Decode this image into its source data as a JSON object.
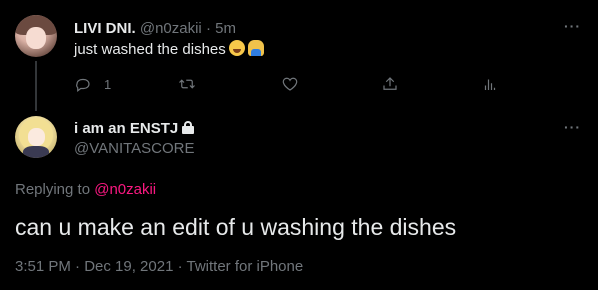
{
  "parent_tweet": {
    "author_name": "LIVI DNI.",
    "author_handle": "@n0zakii",
    "separator": "·",
    "time_ago": "5m",
    "text": "just washed the dishes",
    "emojis": [
      "face-with-tears-of-joy",
      "person-facepalming"
    ],
    "reply_count": "1",
    "more_label": "···"
  },
  "reply_tweet": {
    "author_name": "i am an ENSTJ",
    "author_handle": "@VANITASCORE",
    "protected": true,
    "more_label": "···",
    "replying_prefix": "Replying to",
    "replying_to": "@n0zakii",
    "text": "can u make an edit of u washing the dishes",
    "timestamp": "3:51 PM · Dec 19, 2021 · Twitter for iPhone"
  },
  "colors": {
    "background": "#000000",
    "primary_text": "#e7e9ea",
    "secondary_text": "#71767b",
    "mention": "#f91880",
    "thread_line": "#333639"
  }
}
